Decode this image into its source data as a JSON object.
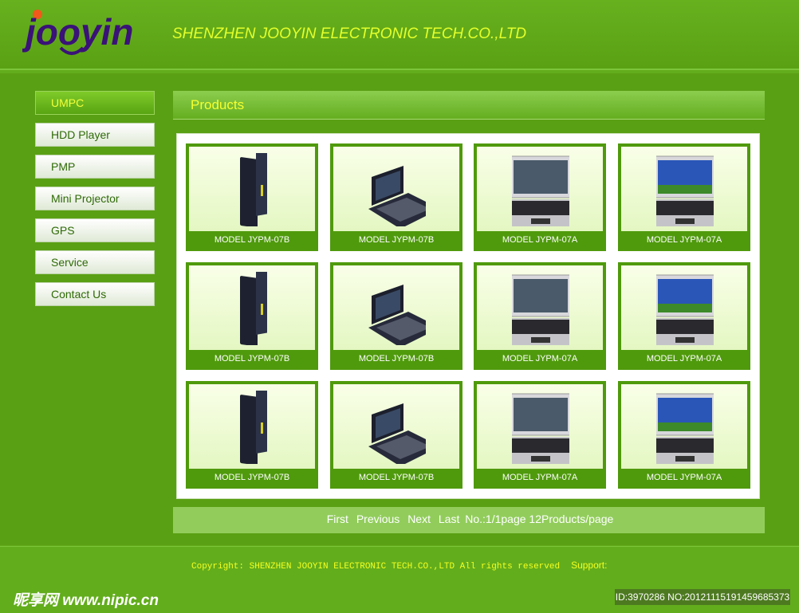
{
  "header": {
    "logo_text": "jooyin",
    "company": "SHENZHEN JOOYIN ELECTRONIC TECH.CO.,LTD"
  },
  "nav": {
    "items": [
      {
        "label": "UMPC",
        "active": true
      },
      {
        "label": "HDD Player"
      },
      {
        "label": " PMP"
      },
      {
        "label": "Mini Projector"
      },
      {
        "label": "GPS"
      },
      {
        "label": "Service"
      },
      {
        "label": "Contact Us"
      }
    ]
  },
  "products": {
    "title": "Products",
    "items": [
      {
        "label": "MODEL JYPM-07B",
        "style": "side"
      },
      {
        "label": "MODEL JYPM-07B",
        "style": "open-dark"
      },
      {
        "label": "MODEL JYPM-07A",
        "style": "silver"
      },
      {
        "label": "MODEL JYPM-07A",
        "style": "silver-xp"
      },
      {
        "label": "MODEL JYPM-07B",
        "style": "side"
      },
      {
        "label": "MODEL JYPM-07B",
        "style": "open-dark"
      },
      {
        "label": "MODEL JYPM-07A",
        "style": "silver"
      },
      {
        "label": "MODEL JYPM-07A",
        "style": "silver-xp"
      },
      {
        "label": "MODEL JYPM-07B",
        "style": "side"
      },
      {
        "label": "MODEL JYPM-07B",
        "style": "open-dark"
      },
      {
        "label": "MODEL JYPM-07A",
        "style": "silver"
      },
      {
        "label": "MODEL JYPM-07A",
        "style": "silver-xp"
      }
    ]
  },
  "pager": {
    "first": "First",
    "previous": "Previous",
    "next": "Next",
    "last": "Last",
    "page_info": "No.:1/1page",
    "per_page": "12Products/page"
  },
  "footer": {
    "copyright": "Copyright: SHENZHEN JOOYIN ELECTRONIC TECH.CO.,LTD All rights reserved",
    "support": "Support:"
  },
  "watermark": {
    "text": "昵享网 www.nipic.cn",
    "id": "ID:3970286 NO:20121115191459685373"
  }
}
